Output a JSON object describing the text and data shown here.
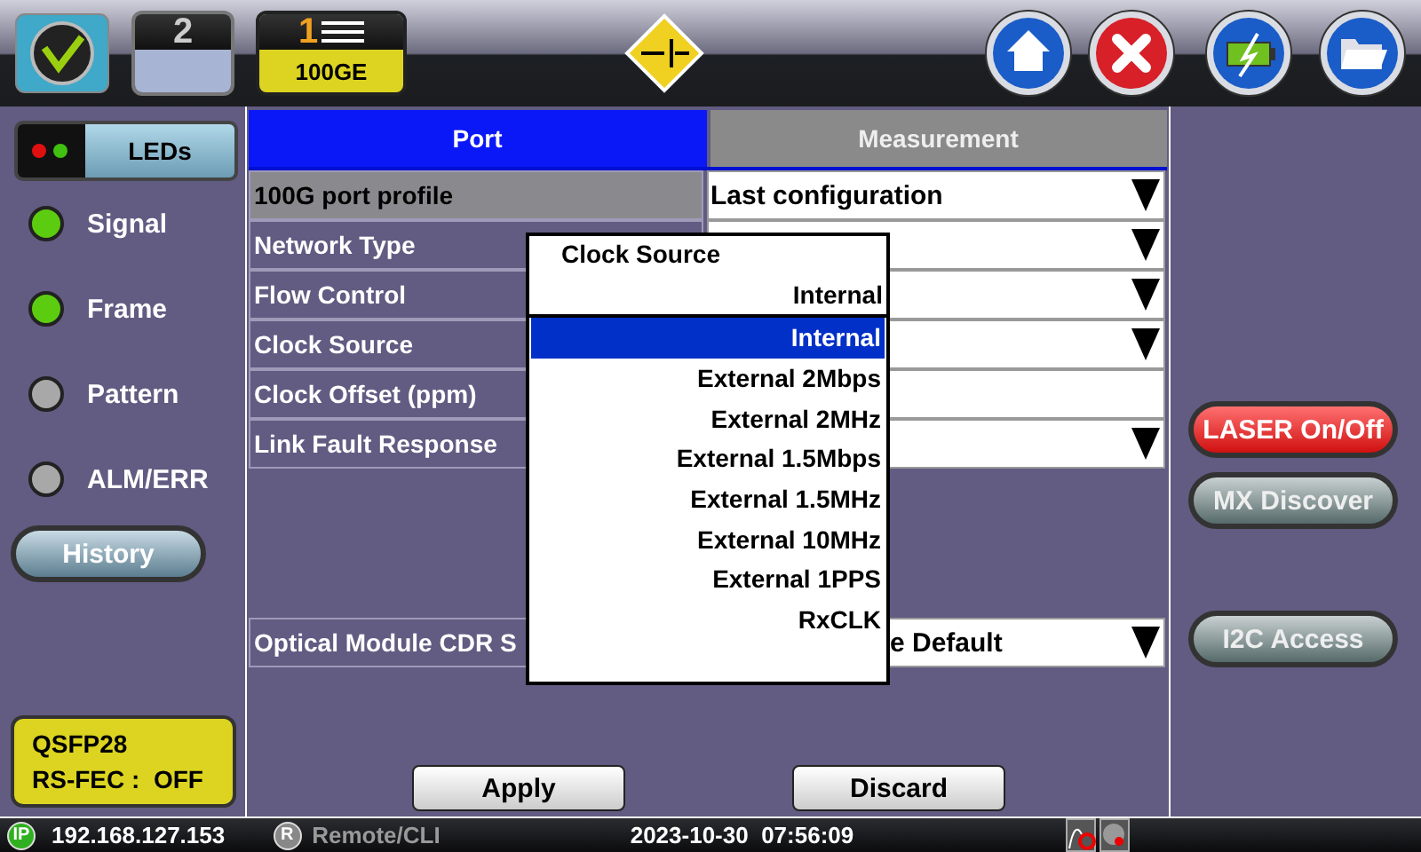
{
  "top_bar": {
    "tabs": [
      {
        "label": "2",
        "selected": false
      },
      {
        "label": "1",
        "sublabel": "100GE",
        "selected": true
      }
    ]
  },
  "sidebar": {
    "leds_button": "LEDs",
    "leds": [
      {
        "label": "Signal",
        "color": "#5ccc10"
      },
      {
        "label": "Frame",
        "color": "#5ccc10"
      },
      {
        "label": "Pattern",
        "color": "#a8a8a8"
      },
      {
        "label": "ALM/ERR",
        "color": "#a8a8a8"
      }
    ],
    "history_button": "History",
    "module_status": [
      "QSFP28",
      "RS-FEC :  OFF"
    ]
  },
  "form": {
    "tabs": [
      {
        "label": "Port",
        "selected": true
      },
      {
        "label": "Measurement",
        "selected": false
      }
    ],
    "rows": [
      {
        "label": "100G port profile",
        "value": "Last configuration",
        "kind": "dropdown",
        "selected": true
      },
      {
        "label": "Network Type",
        "kind": "dropdown",
        "selected": false
      },
      {
        "label": "Flow Control",
        "kind": "dropdown",
        "selected": false
      },
      {
        "label": "Clock Source",
        "kind": "dropdown",
        "selected": false
      },
      {
        "label": "Clock Offset (ppm)",
        "kind": "text",
        "selected": false
      },
      {
        "label": "Link Fault Response",
        "kind": "dropdown",
        "selected": false
      },
      {
        "label": "Optical Module CDR S",
        "value": "e Default",
        "kind": "dropdown",
        "selected": false
      }
    ],
    "buttons": [
      "Apply",
      "Discard"
    ]
  },
  "popup": {
    "title": "Clock Source",
    "current": "Internal",
    "options": [
      {
        "label": "Internal",
        "selected": true
      },
      {
        "label": "External 2Mbps",
        "selected": false
      },
      {
        "label": "External 2MHz",
        "selected": false
      },
      {
        "label": "External 1.5Mbps",
        "selected": false
      },
      {
        "label": "External 1.5MHz",
        "selected": false
      },
      {
        "label": "External 10MHz",
        "selected": false
      },
      {
        "label": "External 1PPS",
        "selected": false
      },
      {
        "label": "RxCLK",
        "selected": false
      }
    ]
  },
  "right_panel": {
    "buttons": [
      {
        "label": "LASER On/Off",
        "kind": "alert"
      },
      {
        "label": "MX Discover",
        "kind": "normal"
      },
      {
        "label": "I2C Access",
        "kind": "normal"
      }
    ]
  },
  "status_bar": {
    "ip_badge": "IP",
    "ip": "192.168.127.153",
    "remote_badge": "R",
    "remote": "Remote/CLI",
    "datetime": "2023-10-30  07:56:09"
  }
}
